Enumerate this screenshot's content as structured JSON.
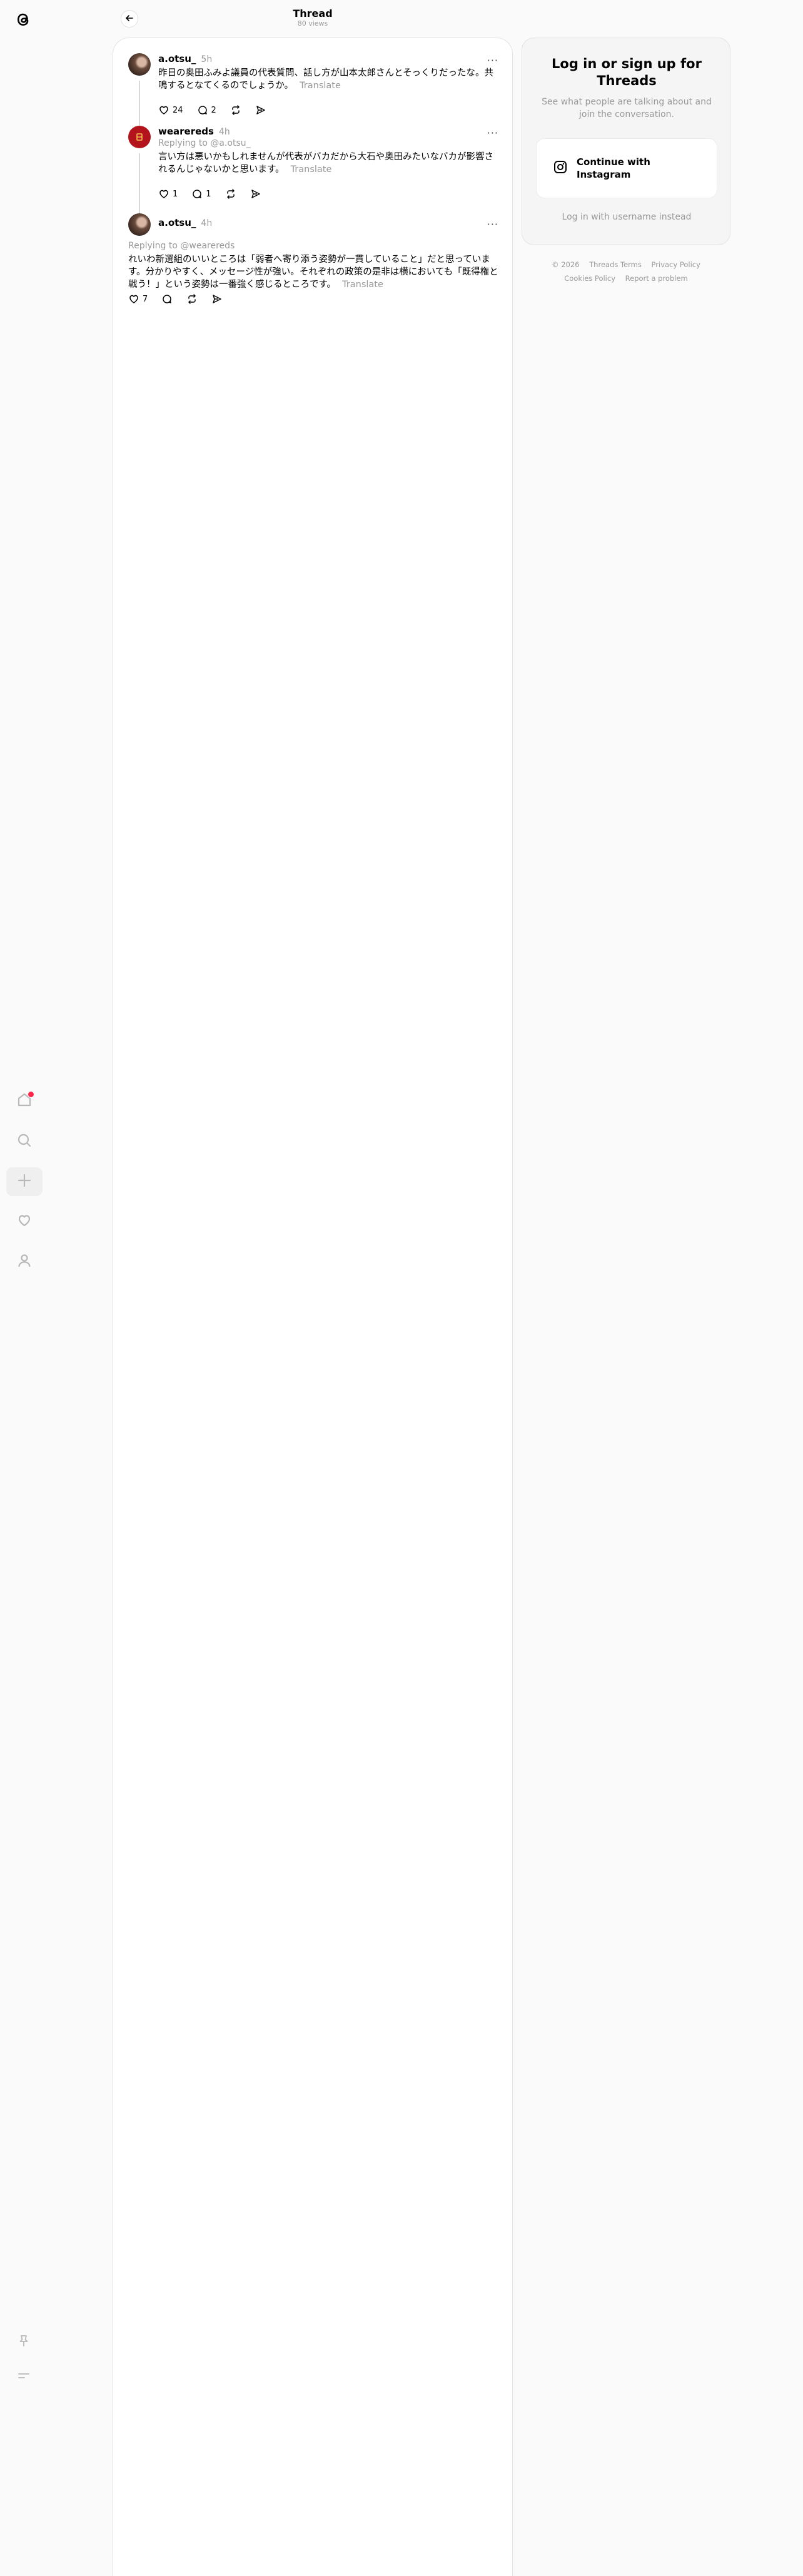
{
  "header": {
    "title": "Thread",
    "views": "80 views"
  },
  "nav": {
    "items": [
      "home-icon",
      "search-icon",
      "create-icon",
      "activity-icon",
      "profile-icon"
    ],
    "bottom": [
      "pin-icon",
      "menu-icon"
    ],
    "notification_color": "#ff2449"
  },
  "posts": [
    {
      "username": "a.otsu_",
      "time": "5h",
      "more": "···",
      "text": "昨日の奥田ふみよ議員の代表質問、話し方が山本太郎さんとそっくりだったな。共鳴するとなてくるのでしょうか。",
      "translate": "Translate",
      "likes": "24",
      "replies": "2"
    },
    {
      "username": "wearereds",
      "time": "4h",
      "more": "···",
      "replying_to": "Replying to @a.otsu_",
      "text": "言い方は悪いかもしれませんが代表がバカだから大石や奥田みたいなバカが影響されるんじゃないかと思います。",
      "translate": "Translate",
      "likes": "1",
      "replies": "1"
    },
    {
      "username": "a.otsu_",
      "time": "4h",
      "more": "···",
      "replying_to": "Replying to @wearereds",
      "text": "れいわ新選組のいいところは「弱者へ寄り添う姿勢が一貫していること」だと思っています。分かりやすく、メッセージ性が強い。それぞれの政策の是非は横においても「既得権と戦う！」という姿勢は一番強く感じるところです。",
      "translate": "Translate",
      "likes": "7"
    }
  ],
  "login": {
    "title": "Log in or sign up for Threads",
    "subtitle": "See what people are talking about and join the conversation.",
    "instagram_button": "Continue with Instagram",
    "username_link": "Log in with username instead"
  },
  "footer": {
    "copyright": "© 2026",
    "links": [
      "Threads Terms",
      "Privacy Policy",
      "Cookies Policy",
      "Report a problem"
    ]
  }
}
